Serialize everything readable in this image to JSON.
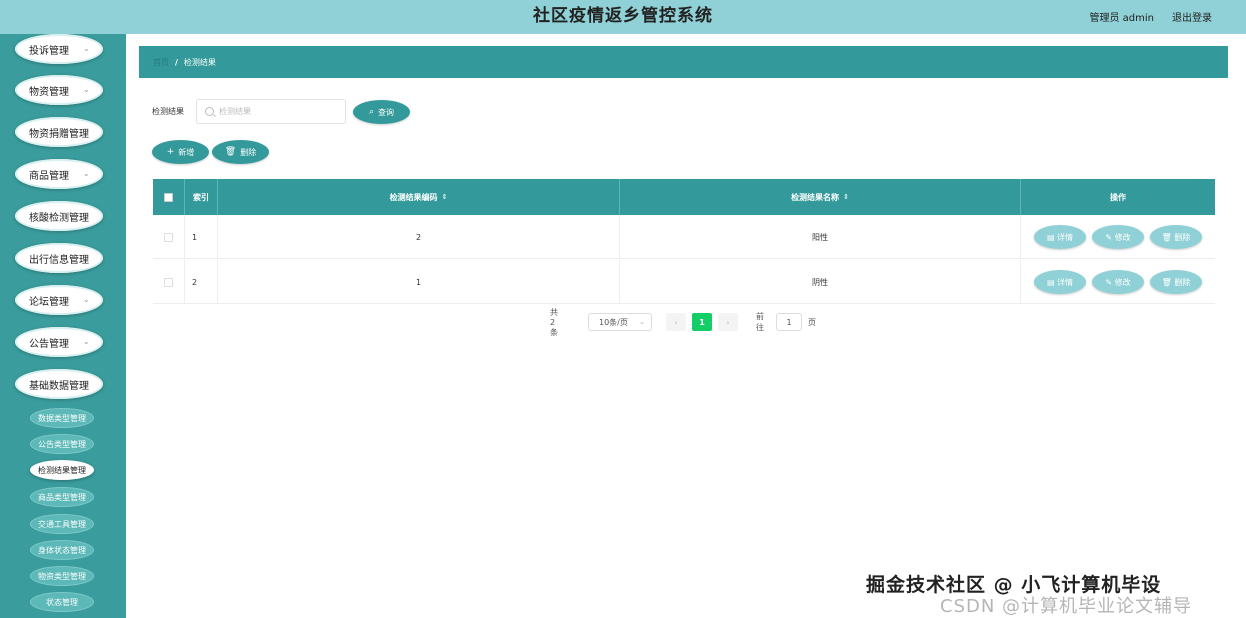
{
  "header": {
    "title": "社区疫情返乡管控系统",
    "user": "管理员 admin",
    "logout": "退出登录"
  },
  "sidebar": {
    "menus": [
      {
        "label": "投诉管理",
        "chevron": true
      },
      {
        "label": "物资管理",
        "chevron": true
      },
      {
        "label": "物资捐赠管理",
        "chevron": false
      },
      {
        "label": "商品管理",
        "chevron": true
      },
      {
        "label": "核酸检测管理",
        "chevron": false
      },
      {
        "label": "出行信息管理",
        "chevron": false
      },
      {
        "label": "论坛管理",
        "chevron": true
      },
      {
        "label": "公告管理",
        "chevron": true
      },
      {
        "label": "基础数据管理",
        "chevron": false
      }
    ],
    "submenus": [
      {
        "label": "数据类型管理",
        "active": false
      },
      {
        "label": "公告类型管理",
        "active": false
      },
      {
        "label": "检测结果管理",
        "active": true
      },
      {
        "label": "商品类型管理",
        "active": false
      },
      {
        "label": "交通工具管理",
        "active": false
      },
      {
        "label": "身体状态管理",
        "active": false
      },
      {
        "label": "物资类型管理",
        "active": false
      },
      {
        "label": "状态管理",
        "active": false
      }
    ]
  },
  "breadcrumb": {
    "home": "首页",
    "separator": "/",
    "current": "检测结果"
  },
  "search": {
    "label": "检测结果",
    "placeholder": "检测结果",
    "button": "查询"
  },
  "actions": {
    "add": "新增",
    "delete": "删除"
  },
  "table": {
    "columns": {
      "index": "索引",
      "code": "检测结果编码",
      "name": "检测结果名称",
      "ops": "操作"
    },
    "rows": [
      {
        "index": "1",
        "code": "2",
        "name": "阳性"
      },
      {
        "index": "2",
        "code": "1",
        "name": "阴性"
      }
    ],
    "op_labels": {
      "detail": "详情",
      "edit": "修改",
      "delete": "删除"
    }
  },
  "pagination": {
    "total": "共 2 条",
    "page_size": "10条/页",
    "current": "1",
    "goto_label": "前往",
    "goto_value": "1",
    "page_unit": "页"
  },
  "watermark": {
    "line1": "掘金技术社区 @ 小飞计算机毕设",
    "line2": "CSDN @计算机毕业论文辅导"
  },
  "colors": {
    "header_bg": "#8fd1d6",
    "sidebar_bg": "#3a9c9c",
    "accent": "#33999a",
    "pager_active": "#13ce66"
  }
}
